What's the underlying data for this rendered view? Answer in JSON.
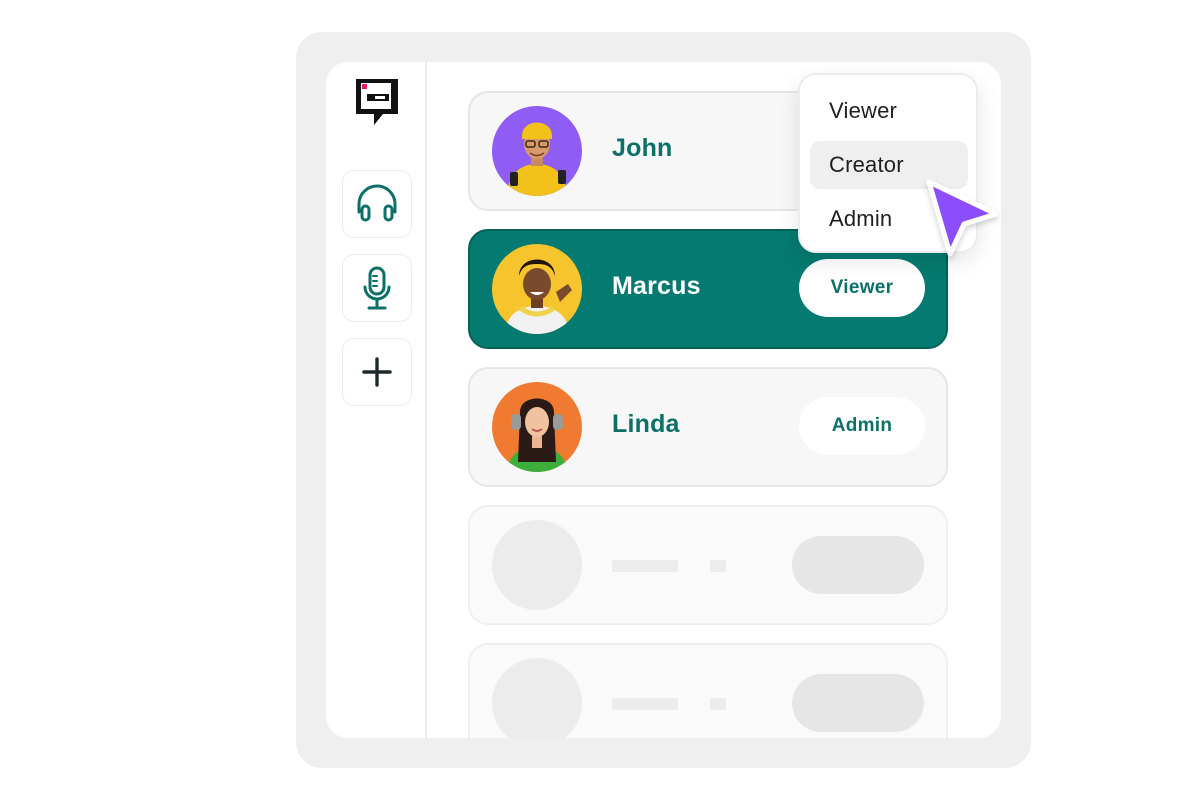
{
  "users": [
    {
      "name": "John",
      "role": ""
    },
    {
      "name": "Marcus",
      "role": "Viewer"
    },
    {
      "name": "Linda",
      "role": "Admin"
    }
  ],
  "role_menu": {
    "options": [
      "Viewer",
      "Creator",
      "Admin"
    ],
    "highlighted": "Creator"
  },
  "sidebar": {
    "icons": [
      "headphones-icon",
      "microphone-icon",
      "plus-icon"
    ]
  },
  "colors": {
    "accent": "#057a70",
    "accent_text": "#0c6f68",
    "cursor": "#8c4dfa",
    "card_bg": "#f7f7f7"
  }
}
